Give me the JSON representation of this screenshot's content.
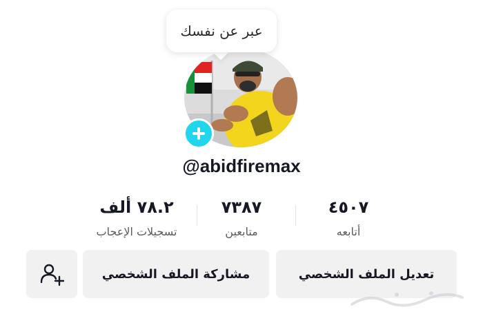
{
  "profile": {
    "bio_prompt": "عبر عن نفسك",
    "username": "@abidfiremax"
  },
  "stats": {
    "likes_value": "٧٨.٢ ألف",
    "likes_label": "تسجيلات الإعجاب",
    "followers_value": "٧٣٨٧",
    "followers_label": "متابعين",
    "following_value": "٤٥٠٧",
    "following_label": "أتابعه"
  },
  "buttons": {
    "edit_profile": "تعديل الملف الشخصي",
    "share_profile": "مشاركة الملف الشخصي"
  },
  "icons": {
    "add_avatar": "plus-icon",
    "add_friend": "add-user-icon"
  },
  "colors": {
    "accent": "#20d5ec",
    "button_bg": "#f1f1f2"
  }
}
